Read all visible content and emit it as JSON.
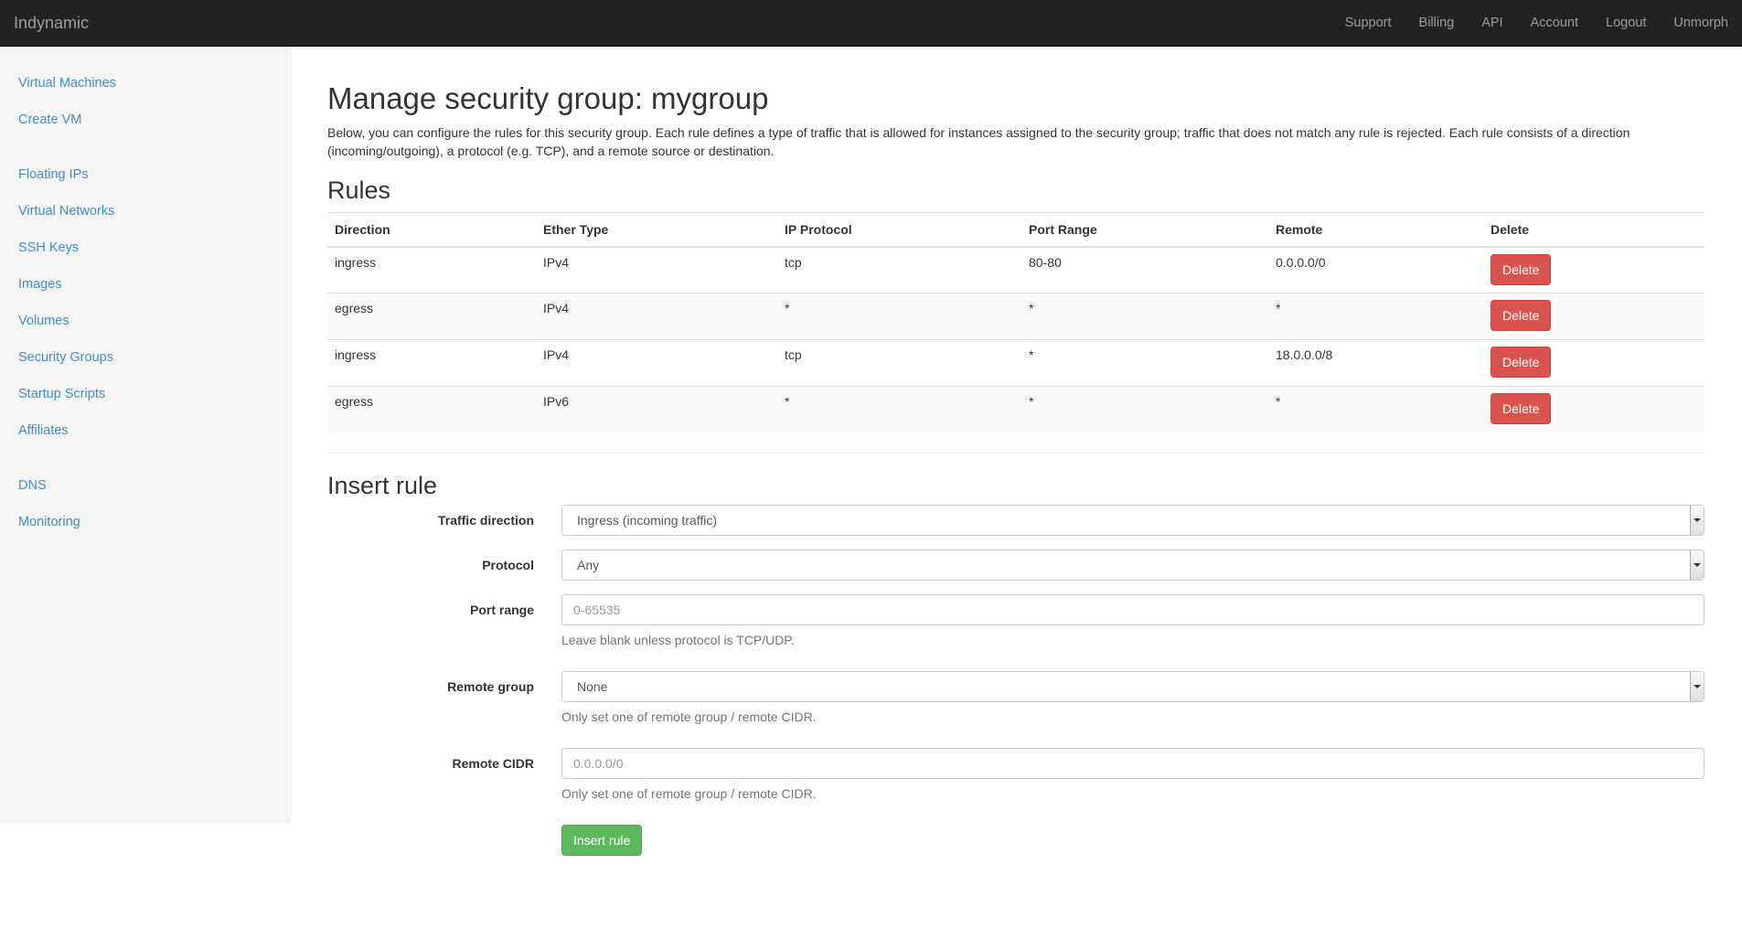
{
  "navbar": {
    "brand": "Indynamic",
    "links": [
      "Support",
      "Billing",
      "API",
      "Account",
      "Logout",
      "Unmorph"
    ]
  },
  "sidebar": {
    "groups": [
      [
        "Virtual Machines",
        "Create VM"
      ],
      [
        "Floating IPs",
        "Virtual Networks",
        "SSH Keys",
        "Images",
        "Volumes",
        "Security Groups",
        "Startup Scripts",
        "Affiliates"
      ],
      [
        "DNS",
        "Monitoring"
      ]
    ]
  },
  "page": {
    "title": "Manage security group: mygroup",
    "intro": "Below, you can configure the rules for this security group. Each rule defines a type of traffic that is allowed for instances assigned to the security group; traffic that does not match any rule is rejected. Each rule consists of a direction (incoming/outgoing), a protocol (e.g. TCP), and a remote source or destination."
  },
  "rules": {
    "heading": "Rules",
    "columns": [
      "Direction",
      "Ether Type",
      "IP Protocol",
      "Port Range",
      "Remote",
      "Delete"
    ],
    "rows": [
      {
        "direction": "ingress",
        "ether": "IPv4",
        "protocol": "tcp",
        "ports": "80-80",
        "remote": "0.0.0.0/0",
        "delete": "Delete"
      },
      {
        "direction": "egress",
        "ether": "IPv4",
        "protocol": "*",
        "ports": "*",
        "remote": "*",
        "delete": "Delete"
      },
      {
        "direction": "ingress",
        "ether": "IPv4",
        "protocol": "tcp",
        "ports": "*",
        "remote": "18.0.0.0/8",
        "delete": "Delete"
      },
      {
        "direction": "egress",
        "ether": "IPv6",
        "protocol": "*",
        "ports": "*",
        "remote": "*",
        "delete": "Delete"
      }
    ]
  },
  "insert": {
    "heading": "Insert rule",
    "traffic_direction": {
      "label": "Traffic direction",
      "value": "Ingress (incoming traffic)"
    },
    "protocol": {
      "label": "Protocol",
      "value": "Any"
    },
    "port_range": {
      "label": "Port range",
      "placeholder": "0-65535",
      "help": "Leave blank unless protocol is TCP/UDP."
    },
    "remote_group": {
      "label": "Remote group",
      "value": "None",
      "help": "Only set one of remote group / remote CIDR."
    },
    "remote_cidr": {
      "label": "Remote CIDR",
      "placeholder": "0.0.0.0/0",
      "help": "Only set one of remote group / remote CIDR."
    },
    "submit": "Insert rule"
  },
  "colors": {
    "navbar": "#222222",
    "link": "#428bca",
    "danger": "#d9534f",
    "success": "#5cb85c"
  }
}
